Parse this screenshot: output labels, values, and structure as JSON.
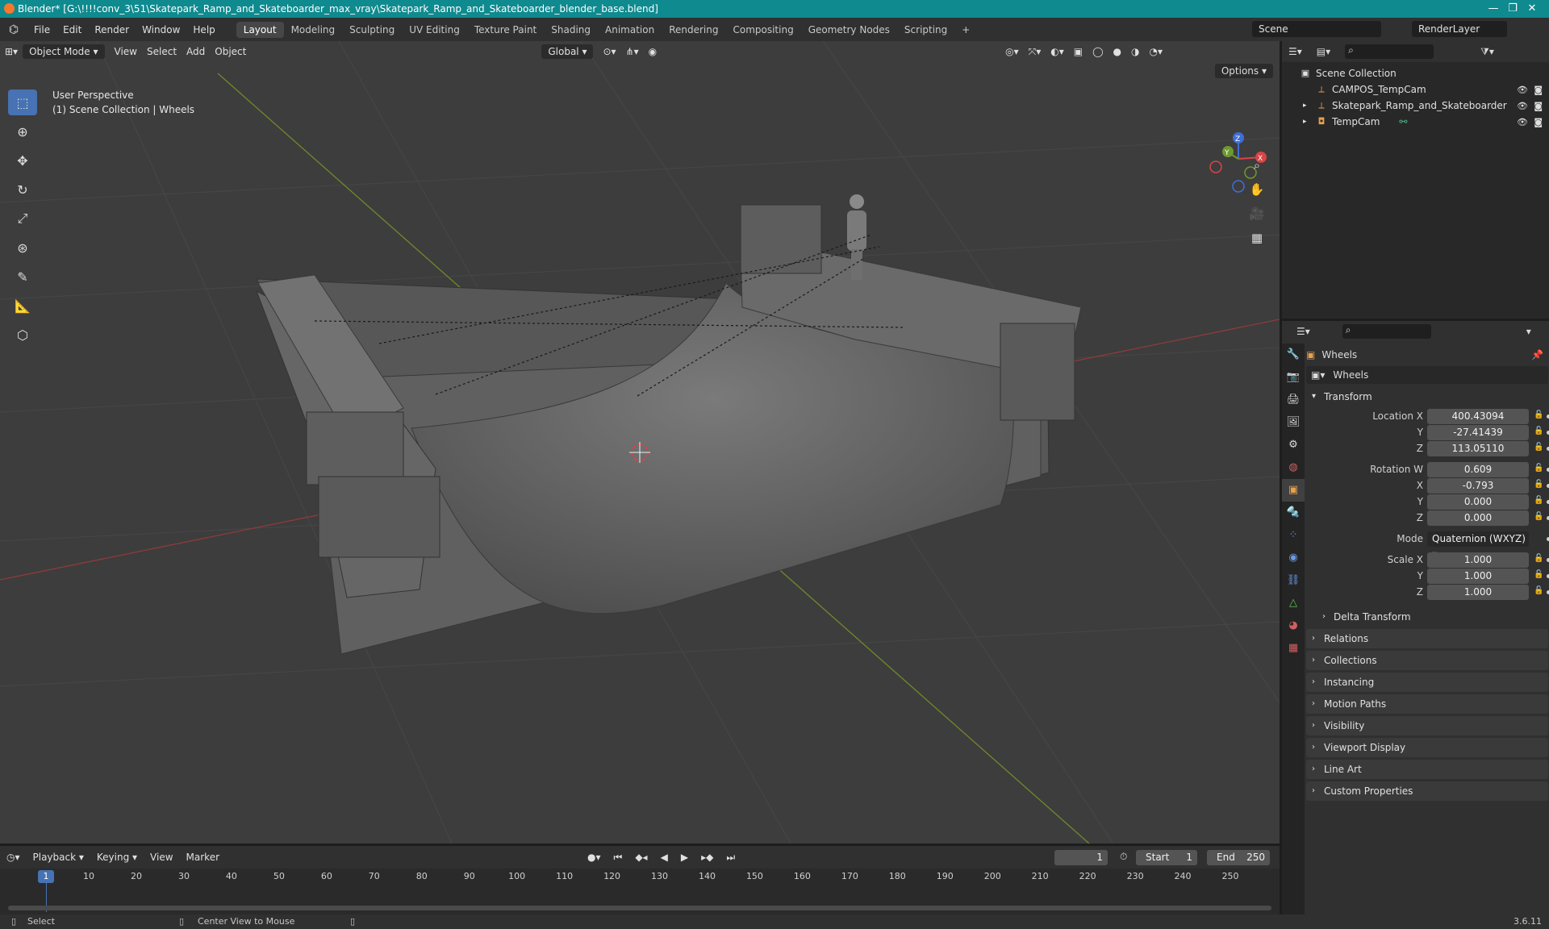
{
  "window": {
    "title": "Blender* [G:\\!!!!conv_3\\51\\Skatepark_Ramp_and_Skateboarder_max_vray\\Skatepark_Ramp_and_Skateboarder_blender_base.blend]",
    "minimize": "—",
    "maximize": "❐",
    "close": "✕"
  },
  "menu": {
    "file": "File",
    "edit": "Edit",
    "render": "Render",
    "window": "Window",
    "help": "Help"
  },
  "workspaces": [
    "Layout",
    "Modeling",
    "Sculpting",
    "UV Editing",
    "Texture Paint",
    "Shading",
    "Animation",
    "Rendering",
    "Compositing",
    "Geometry Nodes",
    "Scripting"
  ],
  "active_workspace": "Layout",
  "add_workspace": "+",
  "scene": {
    "name": "Scene",
    "render_layer": "RenderLayer"
  },
  "viewport": {
    "mode": "Object Mode",
    "menus": [
      "View",
      "Select",
      "Add",
      "Object"
    ],
    "orientation": "Global",
    "options": "Options",
    "overlay_line1": "User Perspective",
    "overlay_line2": "(1) Scene Collection | Wheels",
    "gizmo": {
      "x": "X",
      "y": "Y",
      "z": "Z"
    }
  },
  "outliner": {
    "root": "Scene Collection",
    "items": [
      {
        "name": "CAMPOS_TempCam",
        "icon": "empty-icon"
      },
      {
        "name": "Skatepark_Ramp_and_Skateboarder",
        "icon": "empty-icon"
      },
      {
        "name": "TempCam",
        "icon": "camera-icon"
      }
    ]
  },
  "properties": {
    "object_name": "Wheels",
    "datablock": "Wheels",
    "transform_label": "Transform",
    "location": {
      "label": "Location X",
      "x": "400.43094",
      "y": "-27.41439",
      "z": "113.05110"
    },
    "rotation": {
      "label": "Rotation W",
      "w": "0.609",
      "x": "-0.793",
      "y": "0.000",
      "z": "0.000"
    },
    "mode_label": "Mode",
    "mode_value": "Quaternion (WXYZ)",
    "scale": {
      "label": "Scale X",
      "x": "1.000",
      "y": "1.000",
      "z": "1.000"
    },
    "axis_y": "Y",
    "axis_z": "Z",
    "axis_x": "X",
    "delta": "Delta Transform",
    "panels": [
      "Relations",
      "Collections",
      "Instancing",
      "Motion Paths",
      "Visibility",
      "Viewport Display",
      "Line Art",
      "Custom Properties"
    ]
  },
  "timeline": {
    "menus": [
      "Playback",
      "Keying",
      "View",
      "Marker"
    ],
    "current_frame": "1",
    "start_label": "Start",
    "start": "1",
    "end_label": "End",
    "end": "250",
    "ticks": [
      "1",
      "10",
      "20",
      "30",
      "40",
      "50",
      "60",
      "70",
      "80",
      "90",
      "100",
      "110",
      "120",
      "130",
      "140",
      "150",
      "160",
      "170",
      "180",
      "190",
      "200",
      "210",
      "220",
      "230",
      "240",
      "250"
    ]
  },
  "status": {
    "select": "Select",
    "center": "Center View to Mouse",
    "version": "3.6.11"
  }
}
